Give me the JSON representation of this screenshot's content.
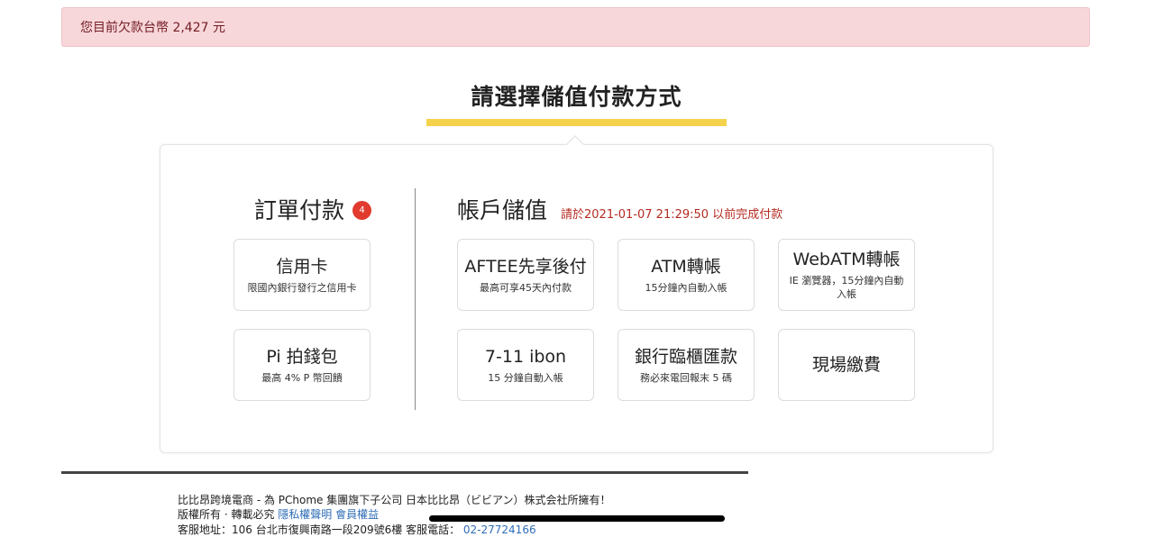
{
  "alert": {
    "text": "您目前欠款台幣 2,427 元"
  },
  "page_title": "請選擇儲值付款方式",
  "order_section": {
    "heading": "訂單付款",
    "badge": "4",
    "cards": [
      {
        "title": "信用卡",
        "subtitle": "限國內銀行發行之信用卡"
      },
      {
        "title": "Pi 拍錢包",
        "subtitle": "最高 4% P 幣回饋"
      }
    ]
  },
  "account_section": {
    "heading": "帳戶儲值",
    "deadline": "請於2021-01-07 21:29:50 以前完成付款",
    "cards": [
      {
        "title": "AFTEE先享後付",
        "subtitle": "最高可享45天內付款"
      },
      {
        "title": "ATM轉帳",
        "subtitle": "15分鐘內自動入帳"
      },
      {
        "title": "WebATM轉帳",
        "subtitle": "IE 瀏覽器，15分鐘內自動入帳"
      },
      {
        "title": "7-11 ibon",
        "subtitle": "15 分鐘自動入帳"
      },
      {
        "title": "銀行臨櫃匯款",
        "subtitle": "務必來電回報末 5 碼"
      },
      {
        "title": "現場繳費",
        "subtitle": ""
      }
    ]
  },
  "footer": {
    "line1": "比比昂跨境電商 - 為 PChome 集團旗下子公司 日本比比昂（ビビアン）株式会社所擁有！",
    "line2_prefix": "版權所有 · 轉載必究",
    "privacy_link": "隱私權聲明",
    "member_link": "會員權益",
    "line3_prefix": "客服地址：106 台北市復興南路一段209號6樓 客服電話：",
    "phone_link": "02-27724166"
  },
  "colors": {
    "alert_bg": "#f8d7da",
    "alert_text": "#721c24",
    "title_underline": "#f5d24b",
    "badge": "#e03b2e",
    "deadline_text": "#b52b22",
    "link": "#2f6db5"
  }
}
